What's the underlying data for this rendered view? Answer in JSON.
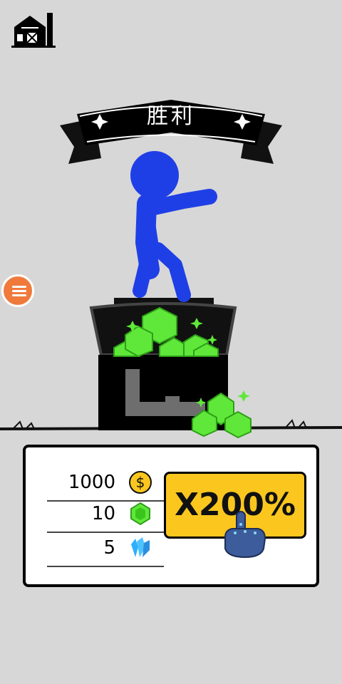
{
  "header": {
    "title": "胜利"
  },
  "icons": {
    "home": "barn-icon",
    "menu": "hamburger-menu-icon",
    "coin": "coin-icon",
    "gem": "green-gem-icon",
    "crystal": "blue-crystal-icon",
    "hand": "pointing-hand-icon"
  },
  "rewards": {
    "coins": "1000",
    "gems": "10",
    "crystals": "5"
  },
  "multiplier": {
    "label": "X200%"
  },
  "colors": {
    "background": "#d7d7d7",
    "stickman": "#1f3fe6",
    "gem": "#5fe83a",
    "button": "#fbc71e",
    "menu": "#f07a3c"
  }
}
